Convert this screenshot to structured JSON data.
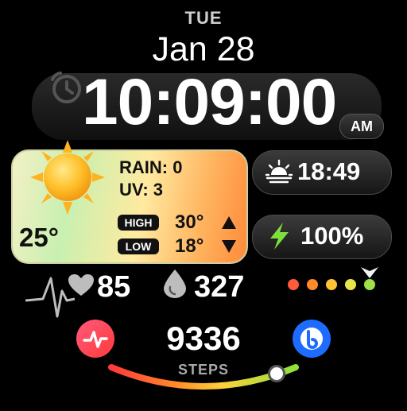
{
  "header": {
    "day": "TUE",
    "date": "Jan 28"
  },
  "clock": {
    "time": "10:09:00",
    "ampm": "AM"
  },
  "weather": {
    "rain_label": "RAIN: 0",
    "uv_label": "UV: 3",
    "temperature": "25°",
    "high_label": "HIGH",
    "high_value": "30°",
    "low_label": "LOW",
    "low_value": "18°"
  },
  "sunrise": {
    "time": "18:49"
  },
  "battery": {
    "level": "100%"
  },
  "health": {
    "heart_rate": "85",
    "water": "327"
  },
  "steps": {
    "count": "9336",
    "label": "STEPS"
  },
  "colors": {
    "dot1": "#ff5a3a",
    "dot2": "#ff8a2a",
    "dot3": "#ffc234",
    "dot4": "#e7e54a",
    "dot5": "#9ee04a",
    "accent_green": "#7ee03a"
  },
  "icons": {
    "alarm": "alarm-clock-icon",
    "sun": "sun-icon",
    "sunrise": "sunrise-icon",
    "battery": "lightning-icon",
    "heart": "heart-icon",
    "water": "droplet-icon",
    "health_app": "pulse-icon",
    "assistant": "bixby-icon"
  }
}
